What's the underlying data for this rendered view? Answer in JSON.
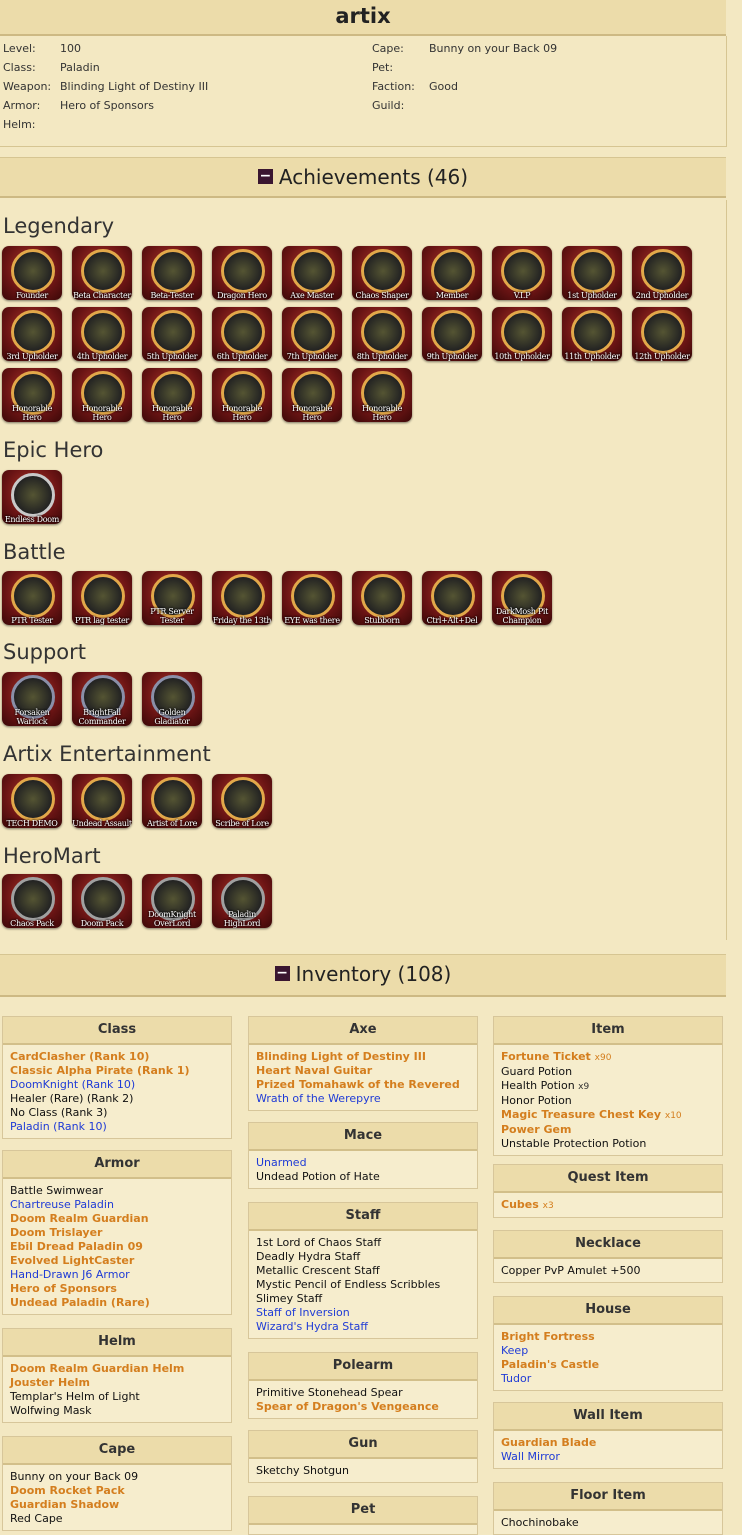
{
  "character": {
    "name": "artix",
    "info_left": [
      {
        "label": "Level:",
        "value": "100"
      },
      {
        "label": "Class:",
        "value": "Paladin"
      },
      {
        "label": "Weapon:",
        "value": "Blinding Light of Destiny III"
      },
      {
        "label": "Armor:",
        "value": "Hero of Sponsors"
      },
      {
        "label": "Helm:",
        "value": ""
      }
    ],
    "info_right": [
      {
        "label": "Cape:",
        "value": "Bunny on your Back 09"
      },
      {
        "label": "Pet:",
        "value": ""
      },
      {
        "label": "Faction:",
        "value": "Good"
      },
      {
        "label": "Guild:",
        "value": ""
      }
    ]
  },
  "achievements": {
    "toggle_icon": "minus-icon",
    "title": "Achievements (46)",
    "categories": [
      {
        "name": "Legendary",
        "badges": [
          "Founder",
          "Beta Character",
          "Beta-Tester",
          "Dragon Hero",
          "Axe Master",
          "Chaos Shaper",
          "Member",
          "V.I.P",
          "1st Upholder",
          "2nd Upholder",
          "3rd Upholder",
          "4th Upholder",
          "5th Upholder",
          "6th Upholder",
          "7th Upholder",
          "8th Upholder",
          "9th Upholder",
          "10th Upholder",
          "11th Upholder",
          "12th Upholder",
          "Honorable Hero",
          "Honorable Hero",
          "Honorable Hero",
          "Honorable Hero",
          "Honorable Hero",
          "Honorable Hero"
        ]
      },
      {
        "name": "Epic Hero",
        "badges": [
          "Endless Doom"
        ]
      },
      {
        "name": "Battle",
        "badges": [
          "PTR Tester",
          "PTR lag tester",
          "PTR Server Tester",
          "Friday the 13th",
          "EYE was there",
          "Stubborn",
          "Ctrl+Alt+Del",
          "DarkMosh Pit Champion"
        ]
      },
      {
        "name": "Support",
        "badges": [
          "Forsaken Warlock",
          "BrightFall Commander",
          "Golden Gladiator"
        ]
      },
      {
        "name": "Artix Entertainment",
        "badges": [
          "TECH DEMO",
          "Undead Assault",
          "Artist of Lore",
          "Scribe of Lore"
        ]
      },
      {
        "name": "HeroMart",
        "badges": [
          "Chaos Pack",
          "Doom Pack",
          "DoomKnight OverLord",
          "Paladin HighLord"
        ]
      }
    ]
  },
  "inventory": {
    "toggle_icon": "minus-icon",
    "title": "Inventory (108)",
    "colors": {
      "rare": "#d47e1e",
      "member": "#1f3bd6",
      "normal": "#111111"
    },
    "col1": [
      {
        "title": "Class",
        "items": [
          {
            "name": "CardClasher (Rank 10)",
            "style": "orange"
          },
          {
            "name": "Classic Alpha Pirate (Rank 1)",
            "style": "orange"
          },
          {
            "name": "DoomKnight (Rank 10)",
            "style": "blue"
          },
          {
            "name": "Healer (Rare) (Rank 2)",
            "style": "black"
          },
          {
            "name": "No Class (Rank 3)",
            "style": "black"
          },
          {
            "name": "Paladin (Rank 10)",
            "style": "blue"
          }
        ]
      },
      {
        "title": "Armor",
        "items": [
          {
            "name": "Battle Swimwear",
            "style": "black"
          },
          {
            "name": "Chartreuse Paladin",
            "style": "blue"
          },
          {
            "name": "Doom Realm Guardian",
            "style": "orange"
          },
          {
            "name": "Doom Trislayer",
            "style": "orange"
          },
          {
            "name": "Ebil Dread Paladin 09",
            "style": "orange"
          },
          {
            "name": "Evolved LightCaster",
            "style": "orange"
          },
          {
            "name": "Hand-Drawn J6 Armor",
            "style": "blue"
          },
          {
            "name": "Hero of Sponsors",
            "style": "orange"
          },
          {
            "name": "Undead Paladin (Rare)",
            "style": "orange"
          }
        ]
      },
      {
        "title": "Helm",
        "items": [
          {
            "name": "Doom Realm Guardian Helm",
            "style": "orange"
          },
          {
            "name": "Jouster Helm",
            "style": "orange"
          },
          {
            "name": "Templar's Helm of Light",
            "style": "black"
          },
          {
            "name": "Wolfwing Mask",
            "style": "black"
          }
        ]
      },
      {
        "title": "Cape",
        "items": [
          {
            "name": "Bunny on your Back 09",
            "style": "black"
          },
          {
            "name": "Doom Rocket Pack",
            "style": "orange"
          },
          {
            "name": "Guardian Shadow",
            "style": "orange"
          },
          {
            "name": "Red Cape",
            "style": "black"
          }
        ]
      }
    ],
    "col2": [
      {
        "title": "Axe",
        "items": [
          {
            "name": "Blinding Light of Destiny III",
            "style": "orange"
          },
          {
            "name": "Heart Naval Guitar",
            "style": "orange"
          },
          {
            "name": "Prized Tomahawk of the Revered",
            "style": "orange"
          },
          {
            "name": "Wrath of the Werepyre",
            "style": "blue"
          }
        ]
      },
      {
        "title": "Mace",
        "items": [
          {
            "name": "Unarmed",
            "style": "blue"
          },
          {
            "name": "Undead Potion of Hate",
            "style": "black"
          }
        ]
      },
      {
        "title": "Staff",
        "items": [
          {
            "name": "1st Lord of Chaos Staff",
            "style": "black"
          },
          {
            "name": "Deadly Hydra Staff",
            "style": "black"
          },
          {
            "name": "Metallic Crescent Staff",
            "style": "black"
          },
          {
            "name": "Mystic Pencil of Endless Scribbles",
            "style": "black"
          },
          {
            "name": "Slimey Staff",
            "style": "black"
          },
          {
            "name": "Staff of Inversion",
            "style": "blue"
          },
          {
            "name": "Wizard's Hydra Staff",
            "style": "blue"
          }
        ]
      },
      {
        "title": "Polearm",
        "items": [
          {
            "name": "Primitive Stonehead Spear",
            "style": "black"
          },
          {
            "name": "Spear of Dragon's Vengeance",
            "style": "orange"
          }
        ]
      },
      {
        "title": "Gun",
        "items": [
          {
            "name": "Sketchy Shotgun",
            "style": "black"
          }
        ]
      },
      {
        "title": "Pet",
        "items": []
      }
    ],
    "col3": [
      {
        "title": "Item",
        "items": [
          {
            "name": "Fortune Ticket",
            "style": "orange",
            "qty": "x90"
          },
          {
            "name": "Guard Potion",
            "style": "black"
          },
          {
            "name": "Health Potion",
            "style": "black",
            "qty": "x9"
          },
          {
            "name": "Honor Potion",
            "style": "black"
          },
          {
            "name": "Magic Treasure Chest Key",
            "style": "orange",
            "qty": "x10"
          },
          {
            "name": "Power Gem",
            "style": "orange"
          },
          {
            "name": "Unstable Protection Potion",
            "style": "black"
          }
        ]
      },
      {
        "title": "Quest Item",
        "items": [
          {
            "name": "Cubes",
            "style": "orange",
            "qty": "x3"
          }
        ]
      },
      {
        "title": "Necklace",
        "items": [
          {
            "name": "Copper PvP Amulet +500",
            "style": "black"
          }
        ]
      },
      {
        "title": "House",
        "items": [
          {
            "name": "Bright Fortress",
            "style": "orange"
          },
          {
            "name": "Keep",
            "style": "blue"
          },
          {
            "name": "Paladin's Castle",
            "style": "orange"
          },
          {
            "name": "Tudor",
            "style": "blue"
          }
        ]
      },
      {
        "title": "Wall Item",
        "items": [
          {
            "name": "Guardian Blade",
            "style": "orange"
          },
          {
            "name": "Wall Mirror",
            "style": "blue"
          }
        ]
      },
      {
        "title": "Floor Item",
        "items": [
          {
            "name": "Chochinobake",
            "style": "black"
          }
        ]
      }
    ]
  }
}
